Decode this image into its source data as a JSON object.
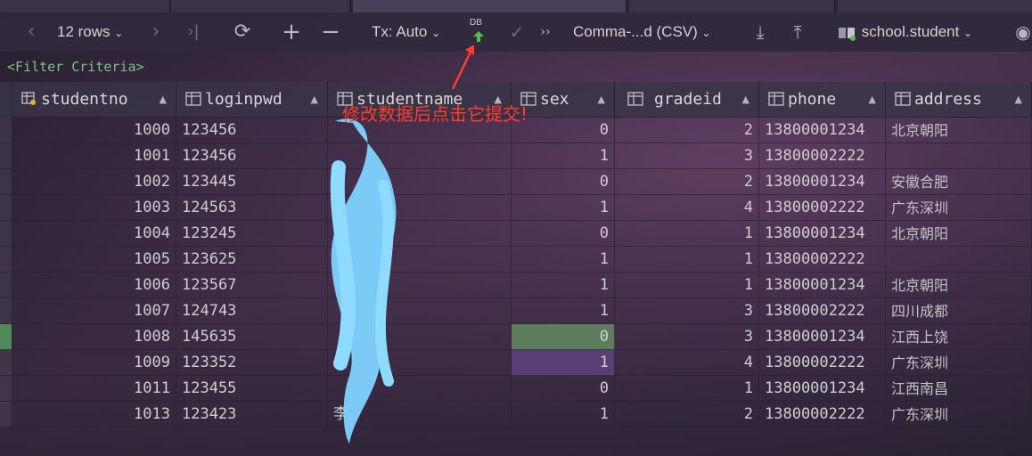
{
  "toolbar": {
    "rows_label": "12 rows",
    "tx_label": "Tx: Auto",
    "db_badge": "DB",
    "export_format": "Comma-...d (CSV)",
    "table_name": "school.student"
  },
  "filter": {
    "label": "<Filter Criteria>"
  },
  "annotation": {
    "text": "修改数据后点击它提交!",
    "color": "#ff3b30"
  },
  "columns": [
    {
      "name": "studentno",
      "icon": "key-column-icon"
    },
    {
      "name": "loginpwd",
      "icon": "column-icon"
    },
    {
      "name": "studentname",
      "icon": "column-icon"
    },
    {
      "name": "sex",
      "icon": "column-icon"
    },
    {
      "name": "gradeid",
      "icon": "column-icon"
    },
    {
      "name": "phone",
      "icon": "column-icon"
    },
    {
      "name": "address",
      "icon": "column-icon"
    }
  ],
  "rows": [
    {
      "studentno": "1000",
      "loginpwd": "123456",
      "studentname": "",
      "sex": "0",
      "gradeid": "2",
      "phone": "13800001234",
      "address": "北京朝阳"
    },
    {
      "studentno": "1001",
      "loginpwd": "123456",
      "studentname": "",
      "sex": "1",
      "gradeid": "3",
      "phone": "13800002222",
      "address": ""
    },
    {
      "studentno": "1002",
      "loginpwd": "123445",
      "studentname": "",
      "sex": "0",
      "gradeid": "2",
      "phone": "13800001234",
      "address": "安徽合肥"
    },
    {
      "studentno": "1003",
      "loginpwd": "124563",
      "studentname": "",
      "sex": "1",
      "gradeid": "4",
      "phone": "13800002222",
      "address": "广东深圳"
    },
    {
      "studentno": "1004",
      "loginpwd": "123245",
      "studentname": "",
      "sex": "0",
      "gradeid": "1",
      "phone": "13800001234",
      "address": "北京朝阳"
    },
    {
      "studentno": "1005",
      "loginpwd": "123625",
      "studentname": "",
      "sex": "1",
      "gradeid": "1",
      "phone": "13800002222",
      "address": ""
    },
    {
      "studentno": "1006",
      "loginpwd": "123567",
      "studentname": "",
      "sex": "1",
      "gradeid": "1",
      "phone": "13800001234",
      "address": "北京朝阳"
    },
    {
      "studentno": "1007",
      "loginpwd": "124743",
      "studentname": "",
      "sex": "1",
      "gradeid": "3",
      "phone": "13800002222",
      "address": "四川成都"
    },
    {
      "studentno": "1008",
      "loginpwd": "145635",
      "studentname": "",
      "sex": "0",
      "gradeid": "3",
      "phone": "13800001234",
      "address": "江西上饶"
    },
    {
      "studentno": "1009",
      "loginpwd": "123352",
      "studentname": "",
      "sex": "1",
      "gradeid": "4",
      "phone": "13800002222",
      "address": "广东深圳"
    },
    {
      "studentno": "1011",
      "loginpwd": "123455",
      "studentname": "",
      "sex": "0",
      "gradeid": "1",
      "phone": "13800001234",
      "address": "江西南昌"
    },
    {
      "studentno": "1013",
      "loginpwd": "123423",
      "studentname": "李",
      "sex": "1",
      "gradeid": "2",
      "phone": "13800002222",
      "address": "广东深圳"
    }
  ],
  "colors": {
    "modified_cell": "#5e7d5e",
    "selected_cell": "#5a3f74",
    "modified_gutter": "#4e8a5a",
    "redaction": "#7fd3ff"
  }
}
